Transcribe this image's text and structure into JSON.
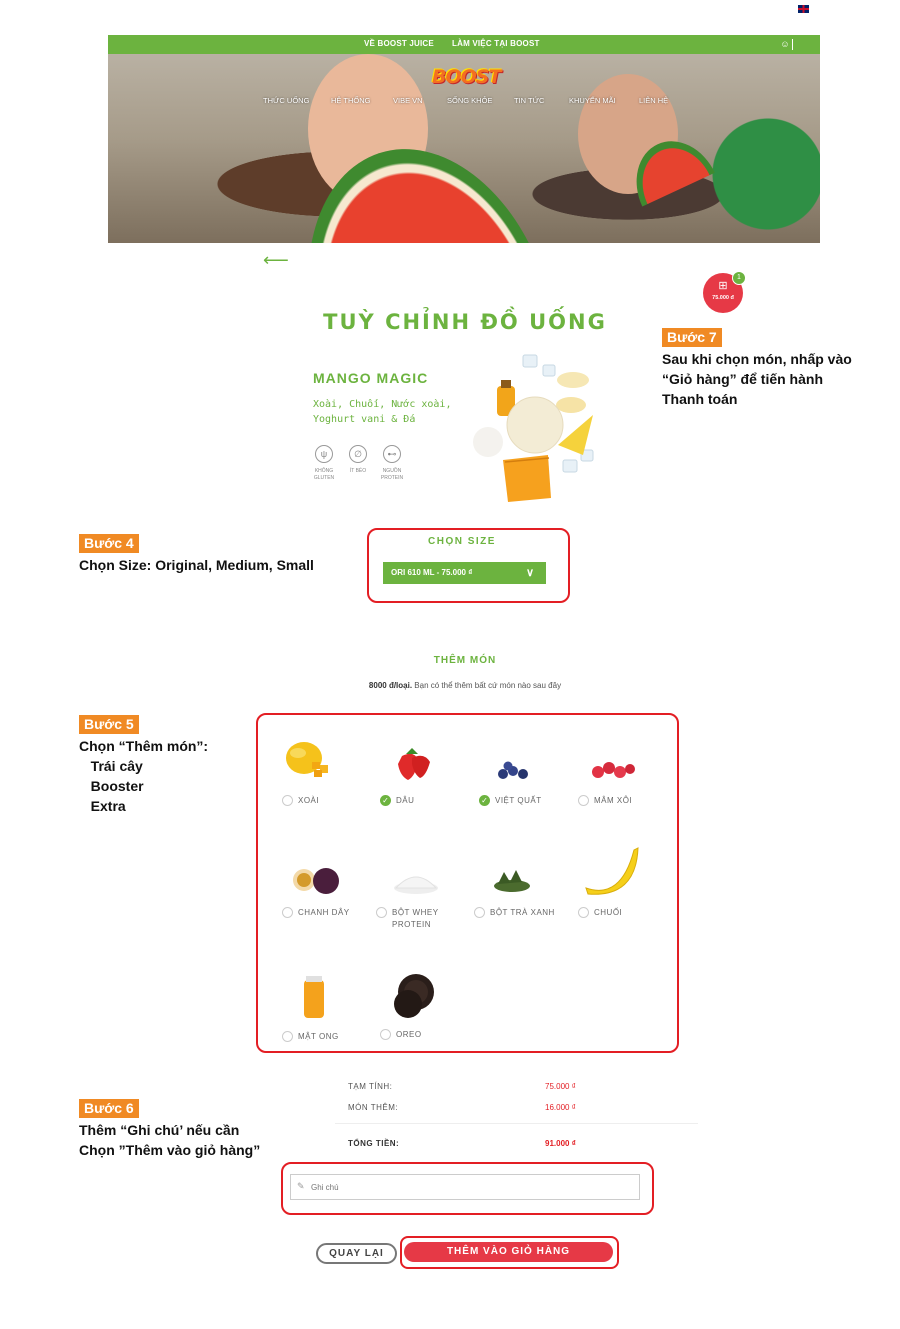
{
  "topbar": {
    "links": [
      "VỀ BOOST JUICE",
      "LÀM VIỆC TẠI BOOST"
    ],
    "user_icon": "user-icon",
    "language_icon": "uk-flag-icon",
    "color": "#6cb33f"
  },
  "header": {
    "logo": "BOOST",
    "nav": [
      "THỨC UỐNG",
      "HỆ THỐNG",
      "VIBE VN",
      "SỐNG KHỎE",
      "TIN TỨC",
      "KHUYẾN MÃI",
      "LIÊN HỆ"
    ]
  },
  "back_icon": "arrow-left-icon",
  "cart": {
    "icon": "basket-icon",
    "amount": "75.000 đ",
    "count": "1",
    "color": "#e63946"
  },
  "page_title": "TUỲ CHỈNH ĐỒ UỐNG",
  "product": {
    "name": "MANGO MAGIC",
    "description": "Xoài, Chuối, Nước xoài, Yoghurt vani & Đá",
    "features": [
      {
        "icon": "wheat-icon",
        "label": "KHÔNG GLUTEN"
      },
      {
        "icon": "leaf-icon",
        "label": "ÍT BÉO"
      },
      {
        "icon": "dumbbell-icon",
        "label": "NGUỒN PROTEIN"
      }
    ]
  },
  "steps": {
    "step4": {
      "tag": "Bước 4",
      "text": "Chọn Size: Original, Medium, Small"
    },
    "step5": {
      "tag": "Bước 5",
      "text": "Chọn “Thêm món”:\n   Trái cây\n   Booster\n   Extra"
    },
    "step6": {
      "tag": "Bước 6",
      "text": "Thêm “Ghi chú’ nếu cần\nChọn ”Thêm vào giỏ hàng”"
    },
    "step7": {
      "tag": "Bước 7",
      "text": "Sau khi chọn món, nhấp vào\n“Giỏ hàng” để tiến hành\nThanh toán"
    }
  },
  "size": {
    "title": "CHỌN SIZE",
    "selected": "ORI 610 ML - 75.000 ₫"
  },
  "extras": {
    "title": "THÊM MÓN",
    "price_note": "8000 đ/loại.",
    "subtitle": "Bạn có thể thêm bất cứ món nào sau đây",
    "items": [
      {
        "name": "XOÀI",
        "checked": false
      },
      {
        "name": "DÂU",
        "checked": true
      },
      {
        "name": "VIỆT QUẤT",
        "checked": true
      },
      {
        "name": "MÂM XÔI",
        "checked": false
      },
      {
        "name": "CHANH DÂY",
        "checked": false
      },
      {
        "name": "BỘT WHEY PROTEIN",
        "checked": false
      },
      {
        "name": "BỘT TRÀ XANH",
        "checked": false
      },
      {
        "name": "CHUỐI",
        "checked": false
      },
      {
        "name": "MẬT ONG",
        "checked": false
      },
      {
        "name": "OREO",
        "checked": false
      }
    ]
  },
  "summary": {
    "subtotal_label": "TẠM TÍNH:",
    "subtotal": "75.000 ₫",
    "extras_label": "MÓN THÊM:",
    "extras": "16.000 ₫",
    "total_label": "TỔNG TIỀN:",
    "total": "91.000 ₫"
  },
  "note": {
    "placeholder": "Ghi chú"
  },
  "buttons": {
    "back": "QUAY LẠI",
    "add_to_cart": "THÊM VÀO GIỎ HÀNG"
  },
  "colors": {
    "accent_green": "#6cb33f",
    "accent_red": "#e63946",
    "annotation_orange": "#f08a24",
    "annotation_box": "#e31e24"
  }
}
